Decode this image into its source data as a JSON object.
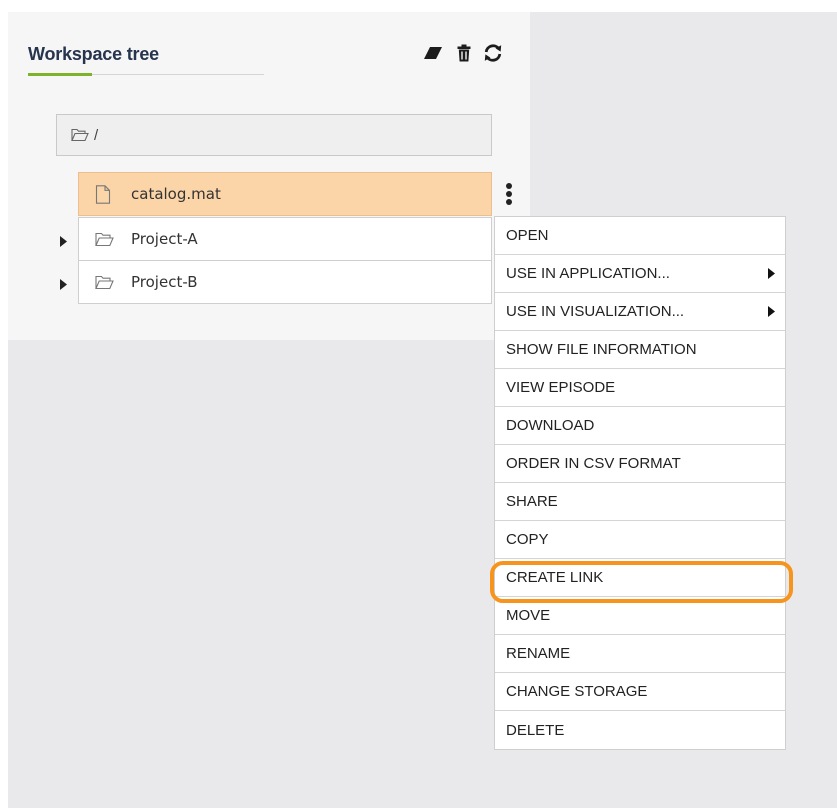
{
  "panel": {
    "title": "Workspace tree",
    "toolbar": {
      "clear_icon": "eraser-icon",
      "delete_icon": "trash-icon",
      "refresh_icon": "refresh-icon"
    }
  },
  "tree": {
    "root_path": "/",
    "items": [
      {
        "name": "catalog.mat",
        "type": "file",
        "selected": true
      },
      {
        "name": "Project-A",
        "type": "folder",
        "expandable": true
      },
      {
        "name": "Project-B",
        "type": "folder",
        "expandable": true
      }
    ]
  },
  "context_menu": {
    "items": [
      {
        "label": "OPEN"
      },
      {
        "label": "USE IN APPLICATION...",
        "submenu": true
      },
      {
        "label": "USE IN VISUALIZATION...",
        "submenu": true
      },
      {
        "label": "SHOW FILE INFORMATION"
      },
      {
        "label": "VIEW EPISODE"
      },
      {
        "label": "DOWNLOAD"
      },
      {
        "label": "ORDER IN CSV FORMAT"
      },
      {
        "label": "SHARE"
      },
      {
        "label": "COPY"
      },
      {
        "label": "CREATE LINK",
        "highlighted": true
      },
      {
        "label": "MOVE"
      },
      {
        "label": "RENAME"
      },
      {
        "label": "CHANGE STORAGE"
      },
      {
        "label": "DELETE"
      }
    ]
  },
  "colors": {
    "title": "#26344d",
    "accent_underline": "#7db22d",
    "selected_row": "#fbd5a8",
    "highlight_outline": "#f7941d",
    "background_gray": "#e9e9ec"
  }
}
